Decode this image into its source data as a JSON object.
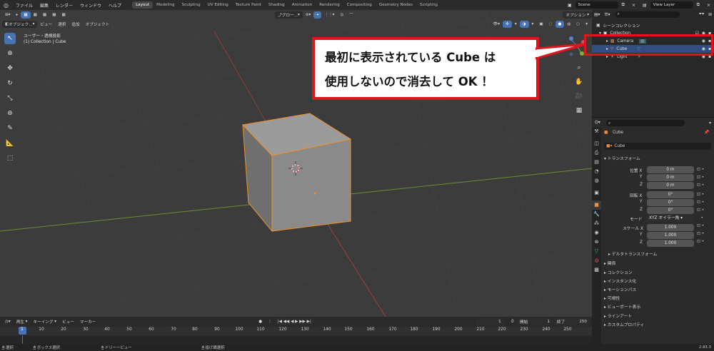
{
  "menubar": {
    "items": [
      "ファイル",
      "編集",
      "レンダー",
      "ウィンドウ",
      "ヘルプ"
    ],
    "workspaces": [
      "Layout",
      "Modeling",
      "Sculpting",
      "UV Editing",
      "Texture Paint",
      "Shading",
      "Animation",
      "Rendering",
      "Compositing",
      "Geometry Nodes",
      "Scripting"
    ],
    "active_workspace": "Layout",
    "scene": "Scene",
    "view_layer": "View Layer"
  },
  "viewport_header": {
    "mode": "オブジェク...",
    "menus": [
      "ビュー",
      "選択",
      "追加",
      "オブジェクト"
    ],
    "transform_orientation": "グロー...",
    "options": "オプション"
  },
  "viewport": {
    "view_name": "ユーザー・透視投影",
    "collection_path": "(1) Collection | Cube"
  },
  "callout": {
    "line1": "最初に表示されている Cube は",
    "line2": "使用しないので消去して OK ！"
  },
  "outliner": {
    "root": "シーンコレクション",
    "collection": "Collection",
    "objects": [
      "Camera",
      "Cube",
      "Light"
    ],
    "selected": "Cube"
  },
  "properties": {
    "object_name": "Cube",
    "data_name": "Cube",
    "transform_header": "トランスフォーム",
    "location_label": "位置 X",
    "rotation_label": "回転 X",
    "scale_label": "スケール X",
    "axis_y": "Y",
    "axis_z": "Z",
    "location": [
      "0 m",
      "0 m",
      "0 m"
    ],
    "rotation": [
      "0°",
      "0°",
      "0°"
    ],
    "scale": [
      "1.000",
      "1.000",
      "1.000"
    ],
    "mode_label": "モード",
    "mode_value": "XYZ オイラー角",
    "delta_transform": "デルタトランスフォーム",
    "sections": [
      "関係",
      "コレクション",
      "インスタンス化",
      "モーションパス",
      "可視性",
      "ビューポート表示",
      "ラインアート",
      "カスタムプロパティ"
    ]
  },
  "timeline": {
    "menus": [
      "再生",
      "キーイング",
      "ビュー",
      "マーカー"
    ],
    "current_frame": "1",
    "start_label": "開始",
    "start": "1",
    "end_label": "終了",
    "end": "250",
    "ticks": [
      "1",
      "10",
      "20",
      "30",
      "40",
      "50",
      "60",
      "70",
      "80",
      "90",
      "100",
      "110",
      "120",
      "130",
      "140",
      "150",
      "160",
      "170",
      "180",
      "190",
      "200",
      "210",
      "220",
      "230",
      "240",
      "250"
    ]
  },
  "statusbar": {
    "items": [
      "選択",
      "ボックス選択",
      "ドリーービュー",
      "投げ縄選択"
    ],
    "version": "2.93.3"
  },
  "colors": {
    "accent": "#4772b3",
    "selection_outline": "#f0902a",
    "callout_border": "#e0141c",
    "x_axis": "#a0403c",
    "y_axis": "#6a8f2f"
  }
}
